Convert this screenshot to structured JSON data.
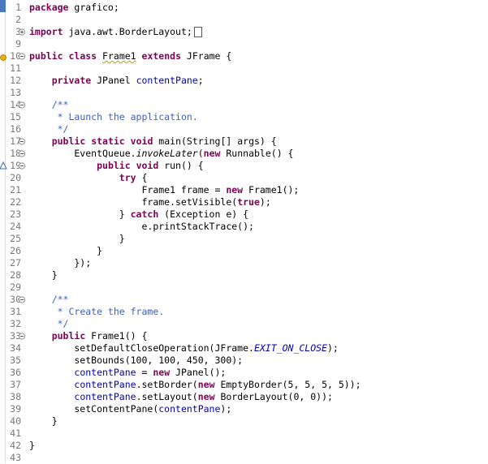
{
  "editor": {
    "lines": [
      {
        "n": "1",
        "marker": "",
        "tokens": [
          [
            "kw",
            "package"
          ],
          [
            "p",
            " grafico;"
          ]
        ]
      },
      {
        "n": "2",
        "marker": "",
        "tokens": []
      },
      {
        "n": "3",
        "marker": "fold-expand",
        "tokens": [
          [
            "kw",
            "import"
          ],
          [
            "p",
            " java.awt.BorderLayout;"
          ],
          [
            "box",
            ""
          ]
        ]
      },
      {
        "n": "9",
        "marker": "",
        "tokens": []
      },
      {
        "n": "10",
        "marker": "warning",
        "tokens": [
          [
            "kw",
            "public"
          ],
          [
            "p",
            " "
          ],
          [
            "kw",
            "class"
          ],
          [
            "p",
            " "
          ],
          [
            "wv",
            "Frame1"
          ],
          [
            "p",
            " "
          ],
          [
            "kw",
            "extends"
          ],
          [
            "p",
            " JFrame {"
          ]
        ]
      },
      {
        "n": "11",
        "marker": "",
        "tokens": []
      },
      {
        "n": "12",
        "marker": "",
        "tokens": [
          [
            "p",
            "    "
          ],
          [
            "kw",
            "private"
          ],
          [
            "p",
            " JPanel "
          ],
          [
            "fld",
            "contentPane"
          ],
          [
            "p",
            ";"
          ]
        ]
      },
      {
        "n": "13",
        "marker": "",
        "tokens": []
      },
      {
        "n": "14",
        "marker": "fold",
        "tokens": [
          [
            "p",
            "    "
          ],
          [
            "cm",
            "/**"
          ]
        ]
      },
      {
        "n": "15",
        "marker": "",
        "tokens": [
          [
            "p",
            "     "
          ],
          [
            "cm",
            "* Launch the application."
          ]
        ]
      },
      {
        "n": "16",
        "marker": "",
        "tokens": [
          [
            "p",
            "     "
          ],
          [
            "cm",
            "*/"
          ]
        ]
      },
      {
        "n": "17",
        "marker": "fold",
        "tokens": [
          [
            "p",
            "    "
          ],
          [
            "kw",
            "public"
          ],
          [
            "p",
            " "
          ],
          [
            "kw",
            "static"
          ],
          [
            "p",
            " "
          ],
          [
            "kw",
            "void"
          ],
          [
            "p",
            " main(String[] args) {"
          ]
        ]
      },
      {
        "n": "18",
        "marker": "fold",
        "tokens": [
          [
            "p",
            "        EventQueue."
          ],
          [
            "it",
            "invokeLater"
          ],
          [
            "p",
            "("
          ],
          [
            "kw",
            "new"
          ],
          [
            "p",
            " Runnable() {"
          ]
        ]
      },
      {
        "n": "19",
        "marker": "override",
        "tokens": [
          [
            "p",
            "            "
          ],
          [
            "kw",
            "public"
          ],
          [
            "p",
            " "
          ],
          [
            "kw",
            "void"
          ],
          [
            "p",
            " run() {"
          ]
        ]
      },
      {
        "n": "20",
        "marker": "",
        "tokens": [
          [
            "p",
            "                "
          ],
          [
            "kw",
            "try"
          ],
          [
            "p",
            " {"
          ]
        ]
      },
      {
        "n": "21",
        "marker": "",
        "tokens": [
          [
            "p",
            "                    Frame1 frame = "
          ],
          [
            "kw",
            "new"
          ],
          [
            "p",
            " Frame1();"
          ]
        ]
      },
      {
        "n": "22",
        "marker": "",
        "tokens": [
          [
            "p",
            "                    frame.setVisible("
          ],
          [
            "kw",
            "true"
          ],
          [
            "p",
            ");"
          ]
        ]
      },
      {
        "n": "23",
        "marker": "",
        "tokens": [
          [
            "p",
            "                } "
          ],
          [
            "kw",
            "catch"
          ],
          [
            "p",
            " (Exception e) {"
          ]
        ]
      },
      {
        "n": "24",
        "marker": "",
        "tokens": [
          [
            "p",
            "                    e.printStackTrace();"
          ]
        ]
      },
      {
        "n": "25",
        "marker": "",
        "tokens": [
          [
            "p",
            "                }"
          ]
        ]
      },
      {
        "n": "26",
        "marker": "",
        "tokens": [
          [
            "p",
            "            }"
          ]
        ]
      },
      {
        "n": "27",
        "marker": "",
        "tokens": [
          [
            "p",
            "        });"
          ]
        ]
      },
      {
        "n": "28",
        "marker": "",
        "tokens": [
          [
            "p",
            "    }"
          ]
        ]
      },
      {
        "n": "29",
        "marker": "",
        "tokens": []
      },
      {
        "n": "30",
        "marker": "fold",
        "tokens": [
          [
            "p",
            "    "
          ],
          [
            "cm",
            "/**"
          ]
        ]
      },
      {
        "n": "31",
        "marker": "",
        "tokens": [
          [
            "p",
            "     "
          ],
          [
            "cm",
            "* Create the frame."
          ]
        ]
      },
      {
        "n": "32",
        "marker": "",
        "tokens": [
          [
            "p",
            "     "
          ],
          [
            "cm",
            "*/"
          ]
        ]
      },
      {
        "n": "33",
        "marker": "fold",
        "tokens": [
          [
            "p",
            "    "
          ],
          [
            "kw",
            "public"
          ],
          [
            "p",
            " Frame1() {"
          ]
        ]
      },
      {
        "n": "34",
        "marker": "",
        "tokens": [
          [
            "p",
            "        setDefaultCloseOperation(JFrame."
          ],
          [
            "st",
            "EXIT_ON_CLOSE"
          ],
          [
            "p",
            ");"
          ]
        ]
      },
      {
        "n": "35",
        "marker": "",
        "tokens": [
          [
            "p",
            "        setBounds(100, 100, 450, 300);"
          ]
        ]
      },
      {
        "n": "36",
        "marker": "",
        "tokens": [
          [
            "p",
            "        "
          ],
          [
            "fld",
            "contentPane"
          ],
          [
            "p",
            " = "
          ],
          [
            "kw",
            "new"
          ],
          [
            "p",
            " JPanel();"
          ]
        ]
      },
      {
        "n": "37",
        "marker": "",
        "tokens": [
          [
            "p",
            "        "
          ],
          [
            "fld",
            "contentPane"
          ],
          [
            "p",
            ".setBorder("
          ],
          [
            "kw",
            "new"
          ],
          [
            "p",
            " EmptyBorder(5, 5, 5, 5));"
          ]
        ]
      },
      {
        "n": "38",
        "marker": "",
        "tokens": [
          [
            "p",
            "        "
          ],
          [
            "fld",
            "contentPane"
          ],
          [
            "p",
            ".setLayout("
          ],
          [
            "kw",
            "new"
          ],
          [
            "p",
            " BorderLayout(0, 0));"
          ]
        ]
      },
      {
        "n": "39",
        "marker": "",
        "tokens": [
          [
            "p",
            "        setContentPane("
          ],
          [
            "fld",
            "contentPane"
          ],
          [
            "p",
            ");"
          ]
        ]
      },
      {
        "n": "40",
        "marker": "",
        "tokens": [
          [
            "p",
            "    }"
          ]
        ]
      },
      {
        "n": "41",
        "marker": "",
        "tokens": []
      },
      {
        "n": "42",
        "marker": "",
        "tokens": [
          [
            "p",
            "}"
          ]
        ]
      },
      {
        "n": "43",
        "marker": "",
        "tokens": []
      }
    ]
  }
}
